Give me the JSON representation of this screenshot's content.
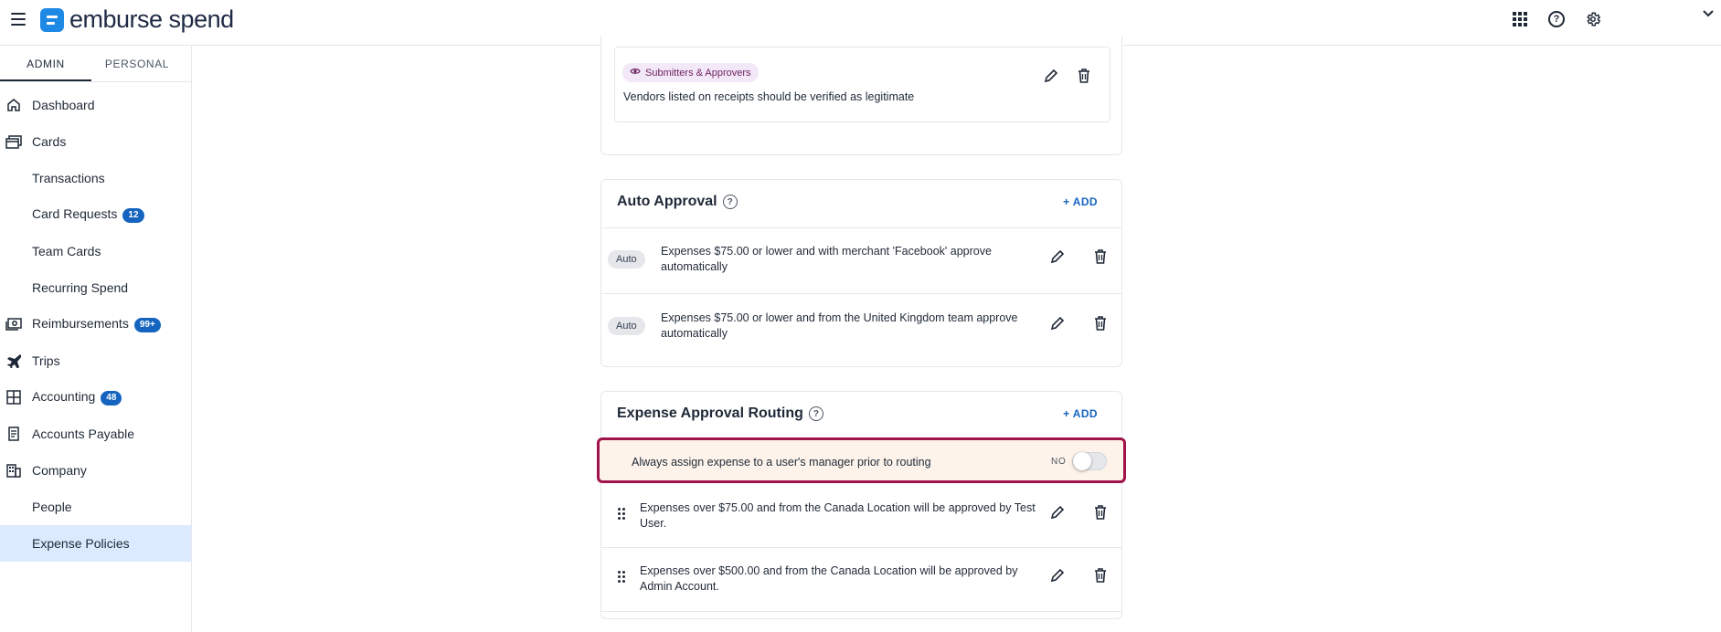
{
  "app": {
    "logo_text": "emburse spend"
  },
  "sidebar": {
    "tabs": [
      {
        "label": "ADMIN",
        "active": true
      },
      {
        "label": "PERSONAL",
        "active": false
      }
    ],
    "items": [
      {
        "label": "Dashboard",
        "icon": "home-icon"
      },
      {
        "label": "Cards",
        "icon": "cards-icon"
      },
      {
        "label": "Transactions",
        "icon": ""
      },
      {
        "label": "Card Requests",
        "icon": "",
        "badge": "12"
      },
      {
        "label": "Team Cards",
        "icon": ""
      },
      {
        "label": "Recurring Spend",
        "icon": ""
      },
      {
        "label": "Reimbursements",
        "icon": "cash-icon",
        "badge": "99+"
      },
      {
        "label": "Trips",
        "icon": "plane-icon"
      },
      {
        "label": "Accounting",
        "icon": "calculator-icon",
        "badge": "48"
      },
      {
        "label": "Accounts Payable",
        "icon": "invoice-icon"
      },
      {
        "label": "Company",
        "icon": "building-icon"
      },
      {
        "label": "People",
        "icon": ""
      },
      {
        "label": "Expense Policies",
        "icon": "",
        "selected": true
      }
    ]
  },
  "vendor_card": {
    "pill_label": "Submitters & Approvers",
    "text": "Vendors listed on receipts should be verified as legitimate"
  },
  "auto_approval": {
    "title": "Auto Approval",
    "add_label": "+ ADD",
    "rows": [
      {
        "pill": "Auto",
        "text_line1": "Expenses $75.00 or lower and with merchant 'Facebook' approve",
        "text_line2": "automatically"
      },
      {
        "pill": "Auto",
        "text_line1": "Expenses $75.00 or lower and from the United Kingdom team approve",
        "text_line2": "automatically"
      }
    ]
  },
  "routing": {
    "title": "Expense Approval Routing",
    "add_label": "+ ADD",
    "manager_toggle": {
      "text": "Always assign expense to a user's manager prior to routing",
      "state_label": "NO"
    },
    "rows": [
      {
        "text_line1": "Expenses over $75.00 and from the Canada Location will be approved by Test",
        "text_line2": "User."
      },
      {
        "text_line1": "Expenses over $500.00 and from the Canada Location will be approved by",
        "text_line2": "Admin Account."
      }
    ]
  },
  "colors": {
    "accent": "#1565c0",
    "highlight_border": "#a0134a",
    "highlight_bg": "#fdf3ea",
    "selected_bg": "#dbeafe"
  }
}
